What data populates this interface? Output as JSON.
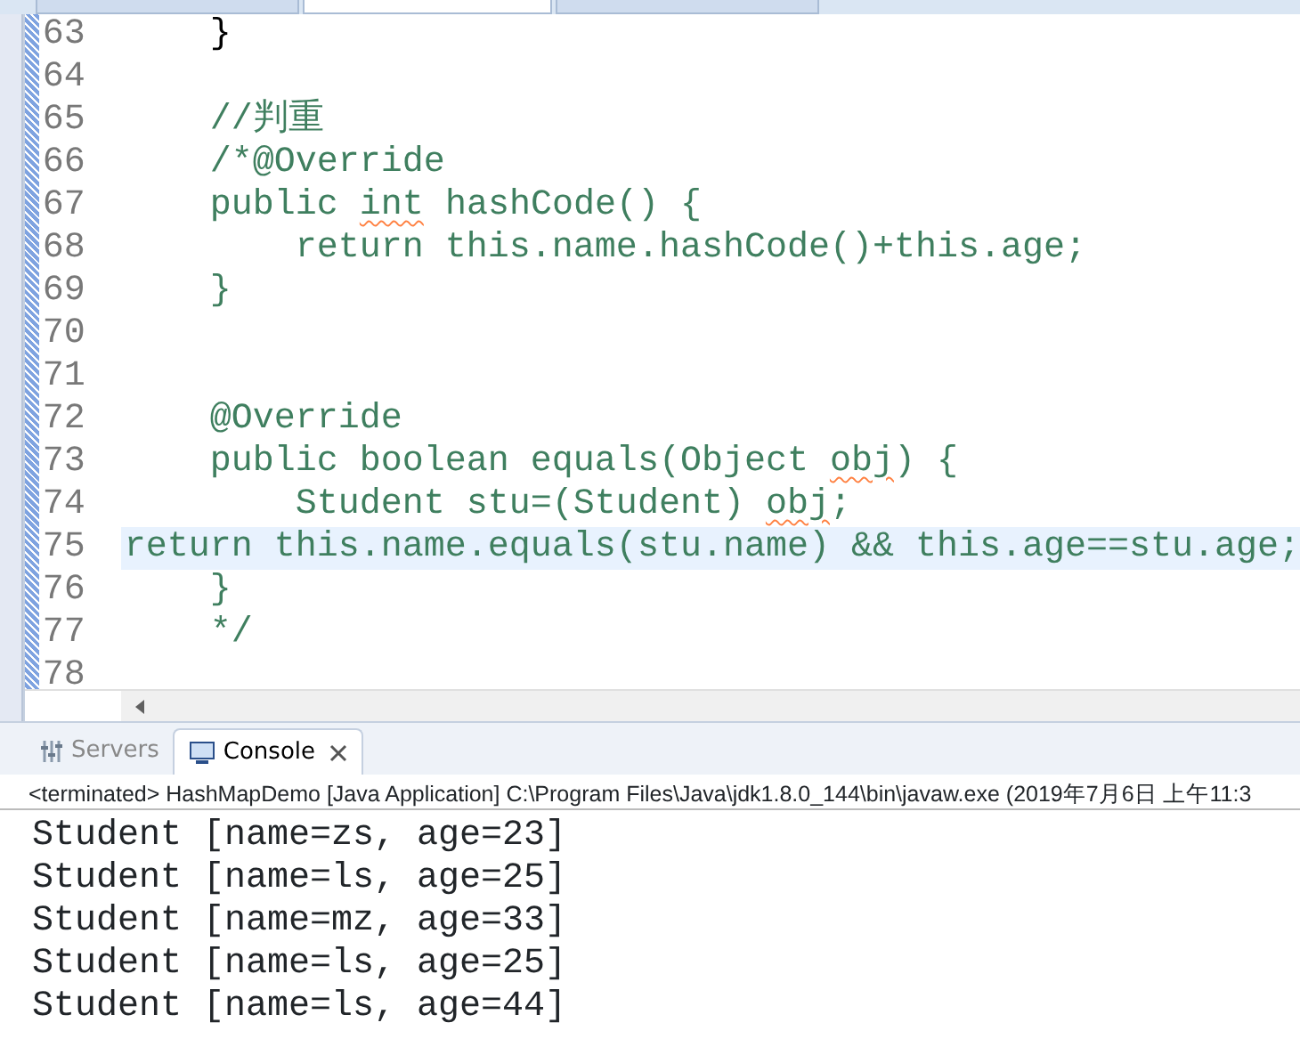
{
  "editor_tabs": [
    {
      "selected": false
    },
    {
      "selected": true
    },
    {
      "selected": false
    }
  ],
  "editor": {
    "lines": [
      {
        "number": "63",
        "current": false,
        "segments": [
          {
            "text": "    }",
            "kind": "code"
          }
        ]
      },
      {
        "number": "64",
        "current": false
      },
      {
        "number": "65",
        "current": false,
        "segments": [
          {
            "text": "    //判重",
            "kind": "comment"
          }
        ]
      },
      {
        "number": "66",
        "current": false,
        "segments": [
          {
            "text": "    /*@Override",
            "kind": "comment"
          }
        ]
      },
      {
        "number": "67",
        "current": false,
        "segments": [
          {
            "text": "    public ",
            "kind": "comment"
          },
          {
            "text": "int",
            "kind": "comment",
            "squiggle": true
          },
          {
            "text": " hashCode() {",
            "kind": "comment"
          }
        ]
      },
      {
        "number": "68",
        "current": false,
        "segments": [
          {
            "text": "        return this.name.hashCode()+this.age;",
            "kind": "comment"
          }
        ]
      },
      {
        "number": "69",
        "current": false,
        "segments": [
          {
            "text": "    }",
            "kind": "comment"
          }
        ]
      },
      {
        "number": "70",
        "current": false
      },
      {
        "number": "71",
        "current": false
      },
      {
        "number": "72",
        "current": false,
        "segments": [
          {
            "text": "    @Override",
            "kind": "comment"
          }
        ]
      },
      {
        "number": "73",
        "current": false,
        "segments": [
          {
            "text": "    public boolean equals(Object ",
            "kind": "comment"
          },
          {
            "text": "obj",
            "kind": "comment",
            "squiggle": true
          },
          {
            "text": ") {",
            "kind": "comment"
          }
        ]
      },
      {
        "number": "74",
        "current": false,
        "segments": [
          {
            "text": "        Student stu=(Student) ",
            "kind": "comment"
          },
          {
            "text": "obj",
            "kind": "comment",
            "squiggle": true
          },
          {
            "text": ";",
            "kind": "comment"
          }
        ]
      },
      {
        "number": "75",
        "current": true,
        "segments": [
          {
            "text": "return this.name.equals(stu.name) && this.age==stu.age;",
            "kind": "comment"
          }
        ]
      },
      {
        "number": "76",
        "current": false,
        "segments": [
          {
            "text": "    }",
            "kind": "comment"
          }
        ]
      },
      {
        "number": "77",
        "current": false,
        "segments": [
          {
            "text": "    */",
            "kind": "comment"
          }
        ]
      },
      {
        "number": "78",
        "current": false
      }
    ]
  },
  "console": {
    "tabs": [
      {
        "label": "Servers",
        "selected": false,
        "kind": "servers"
      },
      {
        "label": "Console",
        "selected": true,
        "kind": "console"
      }
    ],
    "status": "<terminated> HashMapDemo [Java Application] C:\\Program Files\\Java\\jdk1.8.0_144\\bin\\javaw.exe (2019年7月6日 上午11:3",
    "output": [
      "Student [name=zs, age=23]",
      "Student [name=ls, age=25]",
      "Student [name=mz, age=33]",
      "Student [name=ls, age=25]",
      "Student [name=ls, age=44]"
    ]
  }
}
